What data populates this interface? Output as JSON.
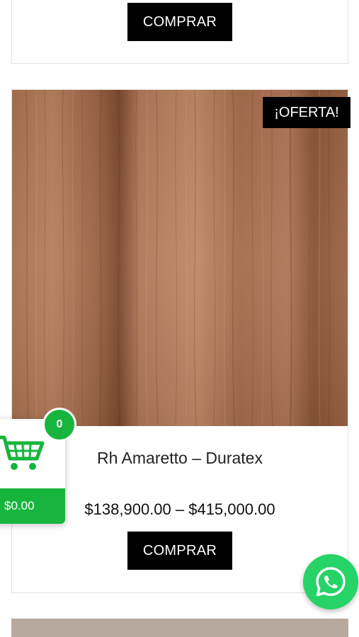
{
  "previous_product": {
    "buy_label": "COMPRAR"
  },
  "product": {
    "badge": "¡OFERTA!",
    "name": "Rh Amaretto – Duratex",
    "price_range": "$138,900.00 – $415,000.00",
    "buy_label": "COMPRAR",
    "image_icon": "wood-texture"
  },
  "cart": {
    "count": "0",
    "total": "$0.00",
    "icon": "cart-icon"
  },
  "whatsapp": {
    "icon": "whatsapp-icon"
  },
  "colors": {
    "accent_green": "#17b53d",
    "whatsapp_green": "#25d366",
    "button_black": "#000000"
  }
}
